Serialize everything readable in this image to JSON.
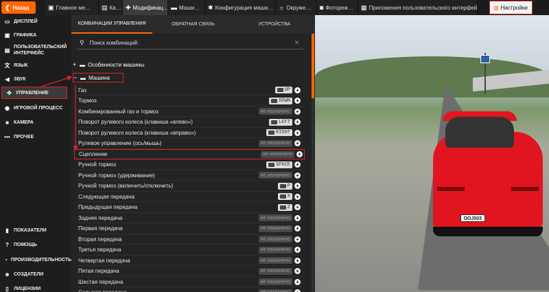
{
  "topbar": {
    "back_label": "Назад",
    "tabs": [
      {
        "label": "Главное ме…",
        "icon": "window-icon"
      },
      {
        "label": "Ка…",
        "icon": "image-icon"
      },
      {
        "label": "Модификац…",
        "icon": "puzzle-icon",
        "active": true
      },
      {
        "label": "Маши…",
        "icon": "car-icon"
      },
      {
        "label": "Конфигурация маши…",
        "icon": "gear-icon"
      },
      {
        "label": "Окруже…",
        "icon": "sun-icon"
      },
      {
        "label": "Фотореж…",
        "icon": "camera-icon"
      },
      {
        "label": "Приложения пользовательского интерфейс…",
        "icon": "apps-icon"
      }
    ],
    "settings_label": "Настройки"
  },
  "sidebar": {
    "items": [
      {
        "label": "Дисплей",
        "icon": "monitor-icon"
      },
      {
        "label": "Графика",
        "icon": "graphics-icon"
      },
      {
        "label": "Пользовательский интерфейс",
        "icon": "ui-icon"
      },
      {
        "label": "Язык",
        "icon": "language-icon"
      },
      {
        "label": "Звук",
        "icon": "sound-icon"
      },
      {
        "label": "Управление",
        "icon": "gamepad-icon",
        "active": true
      },
      {
        "label": "Игровой процесс",
        "icon": "play-icon"
      },
      {
        "label": "Камера",
        "icon": "camera-icon"
      },
      {
        "label": "Прочее",
        "icon": "more-icon"
      },
      {
        "label": "Показатели",
        "icon": "stats-icon"
      },
      {
        "label": "Помощь",
        "icon": "help-icon"
      },
      {
        "label": "Производительность",
        "icon": "performance-icon"
      },
      {
        "label": "Создатели",
        "icon": "people-icon"
      },
      {
        "label": "Лицензии",
        "icon": "document-icon"
      }
    ]
  },
  "panel": {
    "tabs": [
      "Комбинации управления",
      "Обратная связь",
      "Устройства"
    ],
    "search_placeholder": "Поиск комбинаций:",
    "group_collapsed": "Особенности машины",
    "group_expanded": "Машина",
    "not_assigned": "не назначено",
    "bindings": [
      {
        "label": "Газ",
        "key": "UP"
      },
      {
        "label": "Тормоз",
        "key": "DOWN"
      },
      {
        "label": "Комбинированный газ и тормоз",
        "key": null
      },
      {
        "label": "Поворот рулевого колеса (клавиша «влево»)",
        "key": "LEFT"
      },
      {
        "label": "Поворот рулевого колеса (клавиша «вправо»)",
        "key": "RIGHT"
      },
      {
        "label": "Рулевое управление (ось/мышь)",
        "key": null
      },
      {
        "label": "Сцепление",
        "key": null
      },
      {
        "label": "Ручной тормоз",
        "key": "SPACE"
      },
      {
        "label": "Ручной тормоз (удерживание)",
        "key": null
      },
      {
        "label": "Ручной тормоз (включить/отключить)",
        "key": "P"
      },
      {
        "label": "Следующая передача",
        "key": "X"
      },
      {
        "label": "Предыдущая передача",
        "key": "Z"
      },
      {
        "label": "Задняя передача",
        "key": null
      },
      {
        "label": "Первая передача",
        "key": null
      },
      {
        "label": "Вторая передача",
        "key": null
      },
      {
        "label": "Третья передача",
        "key": null
      },
      {
        "label": "Четвертая передача",
        "key": null
      },
      {
        "label": "Пятая передача",
        "key": null
      },
      {
        "label": "Шестая передача",
        "key": null
      },
      {
        "label": "Седьмая передача",
        "key": null
      }
    ]
  },
  "scene": {
    "plate": "DOJ503"
  },
  "colors": {
    "accent": "#ff6600",
    "highlight": "#d9262b"
  }
}
